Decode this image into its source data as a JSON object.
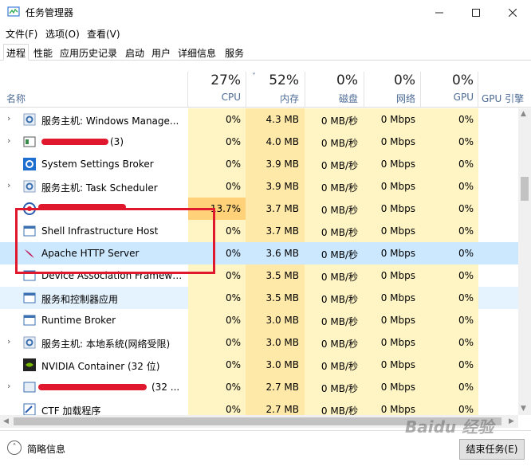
{
  "window": {
    "title": "任务管理器"
  },
  "menu": [
    "文件(F)",
    "选项(O)",
    "查看(V)"
  ],
  "tabs": [
    "进程",
    "性能",
    "应用历史记录",
    "启动",
    "用户",
    "详细信息",
    "服务"
  ],
  "columns": {
    "name": "名称",
    "cpu": {
      "pct": "27%",
      "label": "CPU"
    },
    "memory": {
      "pct": "52%",
      "label": "内存"
    },
    "disk": {
      "pct": "0%",
      "label": "磁盘"
    },
    "network": {
      "pct": "0%",
      "label": "网络"
    },
    "gpu": {
      "pct": "0%",
      "label": "GPU"
    },
    "gpu_engine": {
      "label": "GPU 引擎"
    }
  },
  "processes": [
    {
      "name": "服务主机: Windows Manage...",
      "cpu": "0%",
      "mem": "4.3 MB",
      "disk": "0 MB/秒",
      "net": "0 Mbps",
      "gpu": "0%"
    },
    {
      "name": "(3)",
      "cpu": "0%",
      "mem": "4.0 MB",
      "disk": "0 MB/秒",
      "net": "0 Mbps",
      "gpu": "0%"
    },
    {
      "name": "System Settings Broker",
      "cpu": "0%",
      "mem": "3.9 MB",
      "disk": "0 MB/秒",
      "net": "0 Mbps",
      "gpu": "0%"
    },
    {
      "name": "服务主机: Task Scheduler",
      "cpu": "0%",
      "mem": "3.9 MB",
      "disk": "0 MB/秒",
      "net": "0 Mbps",
      "gpu": "0%"
    },
    {
      "name": "",
      "cpu": "13.7%",
      "mem": "3.7 MB",
      "disk": "0 MB/秒",
      "net": "0 Mbps",
      "gpu": "0%"
    },
    {
      "name": "Shell Infrastructure Host",
      "cpu": "0%",
      "mem": "3.7 MB",
      "disk": "0 MB/秒",
      "net": "0 Mbps",
      "gpu": "0%"
    },
    {
      "name": "Apache HTTP Server",
      "cpu": "0%",
      "mem": "3.6 MB",
      "disk": "0 MB/秒",
      "net": "0 Mbps",
      "gpu": "0%"
    },
    {
      "name": "Device Association Framewo...",
      "cpu": "0%",
      "mem": "3.5 MB",
      "disk": "0 MB/秒",
      "net": "0 Mbps",
      "gpu": "0%"
    },
    {
      "name": "服务和控制器应用",
      "cpu": "0%",
      "mem": "3.5 MB",
      "disk": "0 MB/秒",
      "net": "0 Mbps",
      "gpu": "0%"
    },
    {
      "name": "Runtime Broker",
      "cpu": "0%",
      "mem": "3.0 MB",
      "disk": "0 MB/秒",
      "net": "0 Mbps",
      "gpu": "0%"
    },
    {
      "name": "服务主机: 本地系统(网络受限)",
      "cpu": "0%",
      "mem": "3.0 MB",
      "disk": "0 MB/秒",
      "net": "0 Mbps",
      "gpu": "0%"
    },
    {
      "name": "NVIDIA Container (32 位)",
      "cpu": "0%",
      "mem": "3.0 MB",
      "disk": "0 MB/秒",
      "net": "0 Mbps",
      "gpu": "0%"
    },
    {
      "name": "(32 ...",
      "cpu": "0%",
      "mem": "2.7 MB",
      "disk": "0 MB/秒",
      "net": "0 Mbps",
      "gpu": "0%"
    },
    {
      "name": "CTF 加载程序",
      "cpu": "0%",
      "mem": "2.7 MB",
      "disk": "0 MB/秒",
      "net": "0 Mbps",
      "gpu": "0%"
    }
  ],
  "footer": {
    "fewer_details": "简略信息",
    "end_task": "结束任务(E)"
  },
  "watermark": "Baidu 经验",
  "colors": {
    "cpu_bg": "#fff4c4",
    "mem_bg": "#ffe9a8",
    "hot_cpu_bg": "#ffd27a",
    "selected": "#cce8ff",
    "highlight_box": "#e0182d"
  }
}
